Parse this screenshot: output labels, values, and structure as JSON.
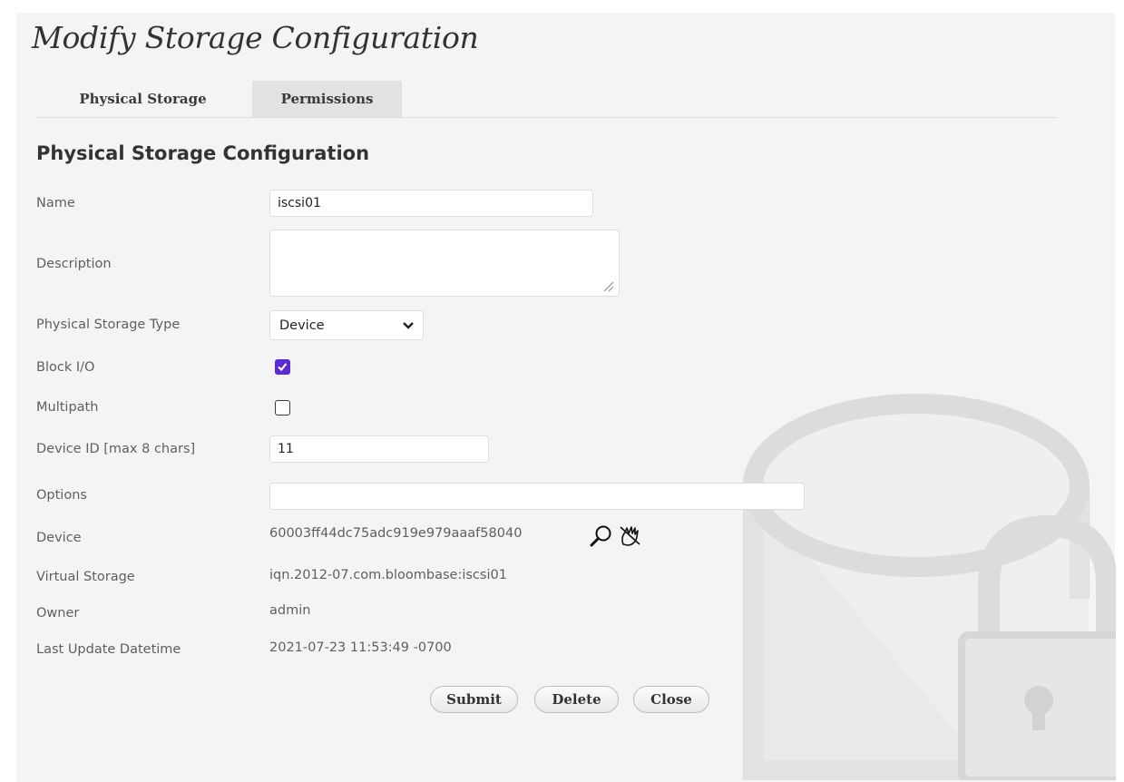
{
  "page": {
    "title": "Modify Storage Configuration"
  },
  "tabs": [
    {
      "label": "Physical Storage",
      "active": true
    },
    {
      "label": "Permissions",
      "active": false
    }
  ],
  "section": {
    "title": "Physical Storage Configuration"
  },
  "form": {
    "name": {
      "label": "Name",
      "value": "iscsi01"
    },
    "description": {
      "label": "Description",
      "value": ""
    },
    "storage_type": {
      "label": "Physical Storage Type",
      "selected": "Device"
    },
    "block_io": {
      "label": "Block I/O",
      "checked": true
    },
    "multipath": {
      "label": "Multipath",
      "checked": false
    },
    "device_id": {
      "label": "Device ID [max 8 chars]",
      "value": "11"
    },
    "options": {
      "label": "Options",
      "value": ""
    },
    "device": {
      "label": "Device",
      "value": "60003ff44dc75adc919e979aaaf58040"
    },
    "virtual_storage": {
      "label": "Virtual Storage",
      "value": "iqn.2012-07.com.bloombase:iscsi01"
    },
    "owner": {
      "label": "Owner",
      "value": "admin"
    },
    "last_update": {
      "label": "Last Update Datetime",
      "value": "2021-07-23 11:53:49 -0700"
    }
  },
  "buttons": {
    "submit": "Submit",
    "delete": "Delete",
    "close": "Close"
  },
  "icons": {
    "device_search": "magnifier-icon",
    "device_clear": "hand-cross-icon",
    "background": "storage-lock-watermark-icon"
  },
  "colors": {
    "checkbox_accent": "#5b2bd6",
    "tab_inactive_bg": "#e2e2e2",
    "page_bg": "#f4f4f4"
  }
}
